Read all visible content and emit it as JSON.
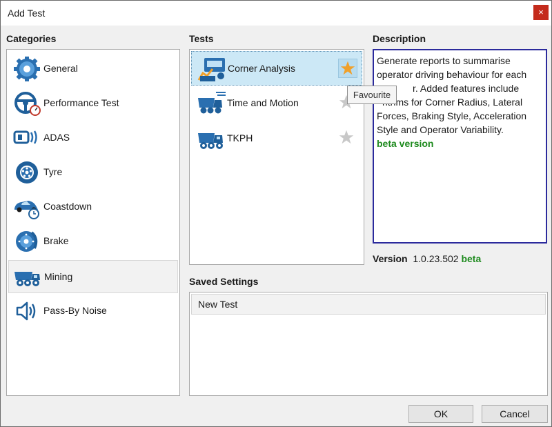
{
  "window": {
    "title": "Add Test",
    "close_icon": "×"
  },
  "categories": {
    "heading": "Categories",
    "items": [
      {
        "label": "General",
        "icon": "gear-icon"
      },
      {
        "label": "Performance Test",
        "icon": "steering-wheel-icon"
      },
      {
        "label": "ADAS",
        "icon": "sensor-icon"
      },
      {
        "label": "Tyre",
        "icon": "tyre-icon"
      },
      {
        "label": "Coastdown",
        "icon": "car-clock-icon"
      },
      {
        "label": "Brake",
        "icon": "brake-disc-icon"
      },
      {
        "label": "Mining",
        "icon": "mining-truck-icon",
        "selected": true
      },
      {
        "label": "Pass-By Noise",
        "icon": "speaker-icon"
      }
    ]
  },
  "tests": {
    "heading": "Tests",
    "items": [
      {
        "label": "Corner Analysis",
        "icon": "truck-chart-icon",
        "favourite": true,
        "selected": true
      },
      {
        "label": "Time and Motion",
        "icon": "truck-clock-icon",
        "favourite": false
      },
      {
        "label": "TKPH",
        "icon": "dump-truck-icon",
        "favourite": false
      }
    ],
    "tooltip": "Favourite"
  },
  "description": {
    "heading": "Description",
    "line1": "Generate reports to summarise",
    "line2": "operator driving behaviour for each",
    "line3": "r. Added features include",
    "line4": "rithms for Corner Radius, Lateral",
    "line5": "Forces, Braking Style, Acceleration",
    "line6": "Style and Operator Variability.",
    "beta_note": "beta version"
  },
  "version": {
    "label": "Version",
    "number": "1.0.23.502",
    "tag": "beta"
  },
  "saved_settings": {
    "heading": "Saved Settings",
    "items": [
      "New Test"
    ]
  },
  "buttons": {
    "ok": "OK",
    "cancel": "Cancel"
  },
  "colors": {
    "accent_blue": "#2a6fb0",
    "beta_green": "#1d8a1d",
    "close_red": "#c42b1c",
    "star_gold": "#f0a02a"
  }
}
